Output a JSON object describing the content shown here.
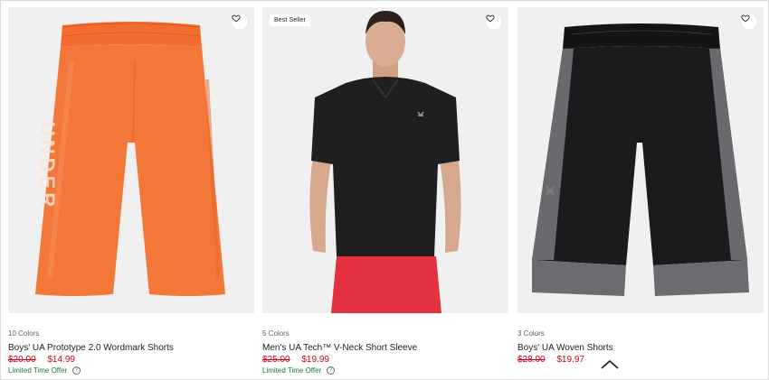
{
  "products": [
    {
      "colors": "10 Colors",
      "name": "Boys' UA Prototype 2.0 Wordmark Shorts",
      "old_price": "$20.00",
      "price": "$14.99",
      "offer": "Limited Time Offer",
      "image": "orange-shorts",
      "badge": ""
    },
    {
      "colors": "5 Colors",
      "name": "Men's UA Tech™ V-Neck Short Sleeve",
      "old_price": "$25.00",
      "price": "$19.99",
      "offer": "Limited Time Offer",
      "image": "black-tshirt-model",
      "badge": "Best Seller"
    },
    {
      "colors": "3 Colors",
      "name": "Boys' UA Woven Shorts",
      "old_price": "$28.00",
      "price": "$19.97",
      "offer": "",
      "image": "black-grey-shorts",
      "badge": ""
    }
  ],
  "shorts_wordmark": "UNDER",
  "info_glyph": "?",
  "icons": {
    "favorite": "heart-outline-icon",
    "info": "info-circle-icon",
    "back_to_top": "chevron-up-icon"
  },
  "colors": {
    "sale_price": "#d0021b",
    "offer_text": "#1b7a36",
    "image_bg": "#f0f0f0"
  }
}
